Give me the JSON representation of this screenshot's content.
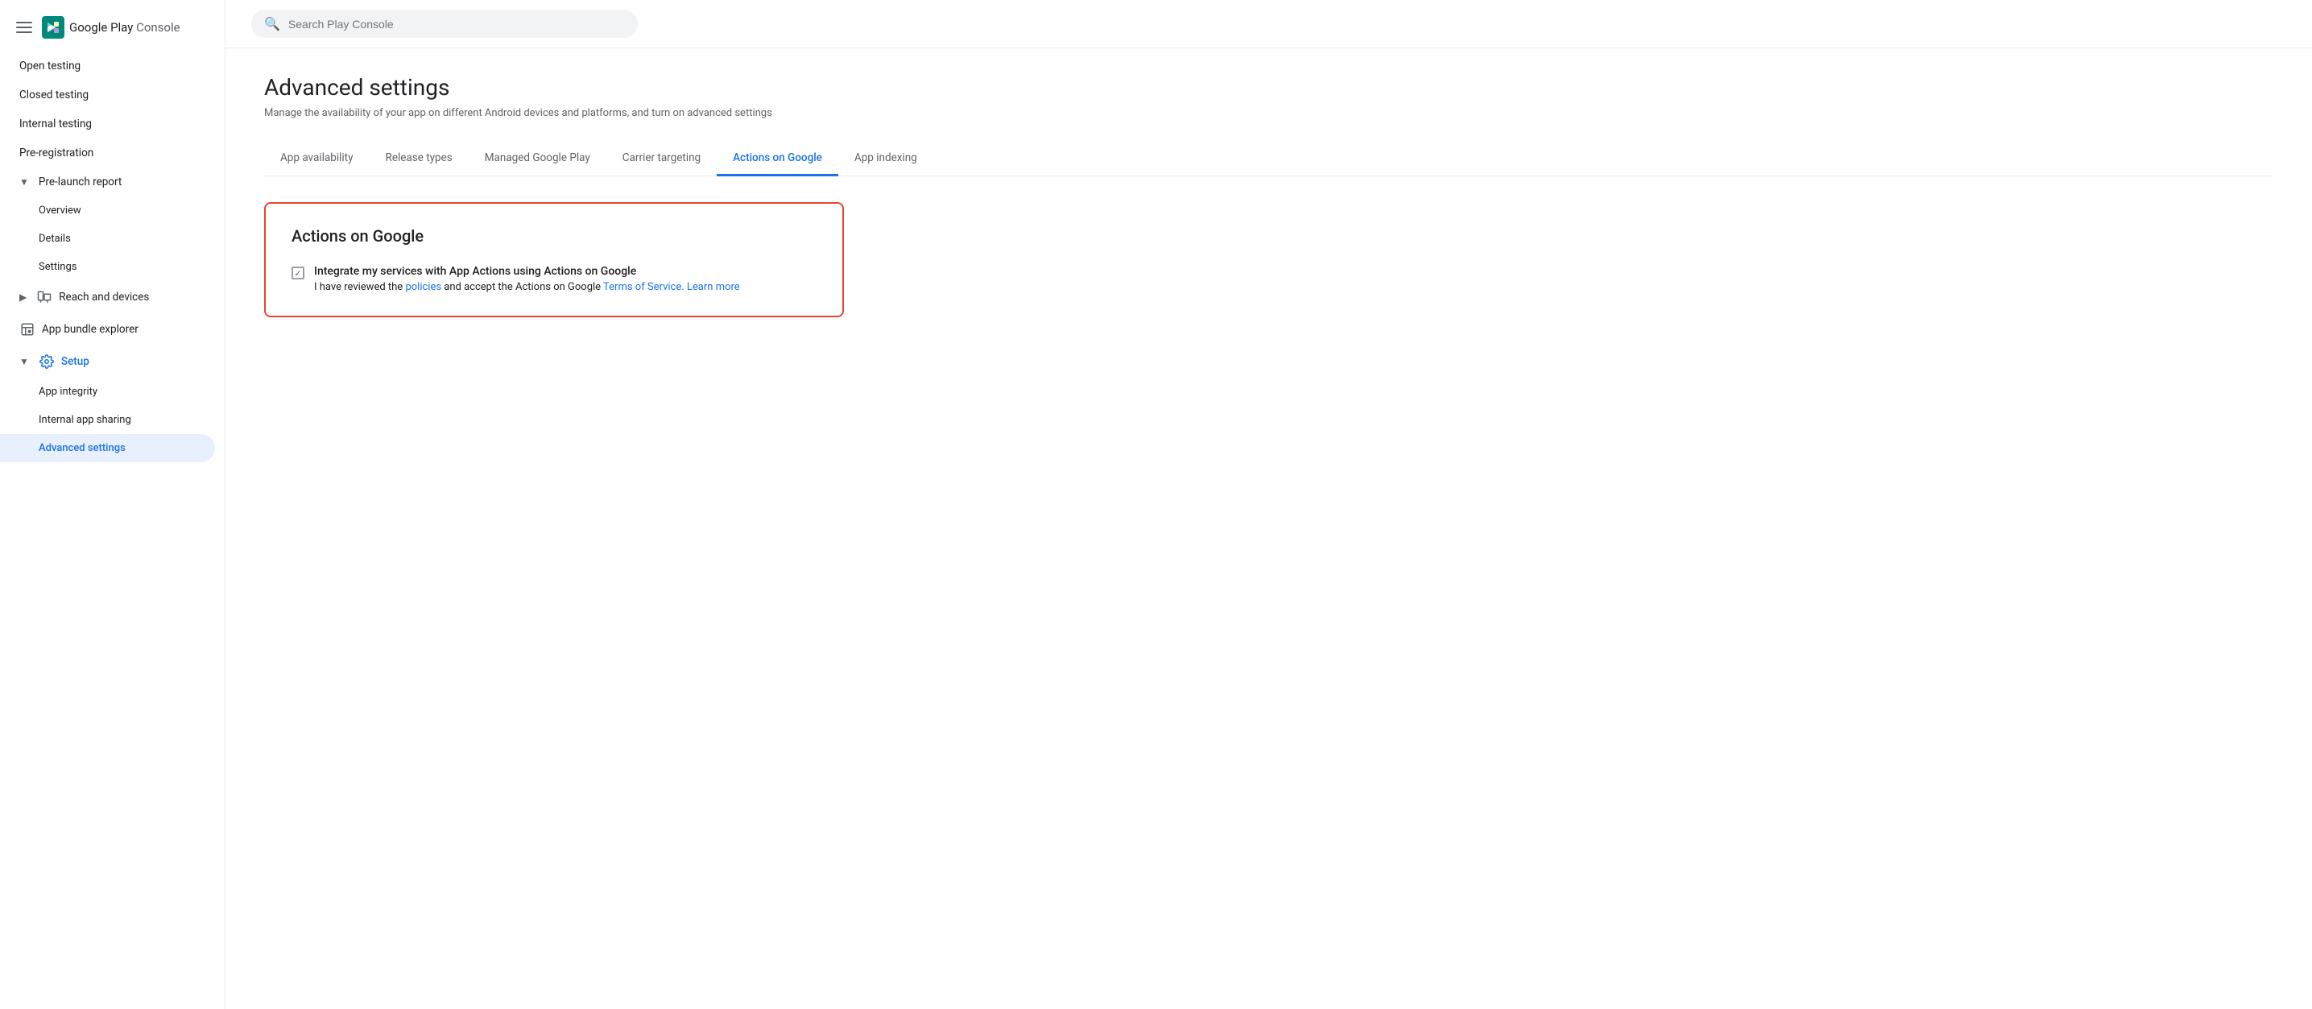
{
  "app": {
    "name": "Google Play Console",
    "name_play": "Google Play",
    "name_console": "Console"
  },
  "search": {
    "placeholder": "Search Play Console"
  },
  "sidebar": {
    "items": [
      {
        "id": "open-testing",
        "label": "Open testing",
        "level": "top"
      },
      {
        "id": "closed-testing",
        "label": "Closed testing",
        "level": "top"
      },
      {
        "id": "internal-testing",
        "label": "Internal testing",
        "level": "top"
      },
      {
        "id": "pre-registration",
        "label": "Pre-registration",
        "level": "top"
      },
      {
        "id": "pre-launch-report",
        "label": "Pre-launch report",
        "level": "section",
        "expanded": true
      },
      {
        "id": "overview",
        "label": "Overview",
        "level": "sub"
      },
      {
        "id": "details",
        "label": "Details",
        "level": "sub"
      },
      {
        "id": "settings",
        "label": "Settings",
        "level": "sub"
      },
      {
        "id": "reach-and-devices",
        "label": "Reach and devices",
        "level": "section-collapsed"
      },
      {
        "id": "app-bundle-explorer",
        "label": "App bundle explorer",
        "level": "top-icon"
      },
      {
        "id": "setup",
        "label": "Setup",
        "level": "section-active",
        "expanded": true
      },
      {
        "id": "app-integrity",
        "label": "App integrity",
        "level": "sub"
      },
      {
        "id": "internal-app-sharing",
        "label": "Internal app sharing",
        "level": "sub"
      },
      {
        "id": "advanced-settings",
        "label": "Advanced settings",
        "level": "sub-active"
      }
    ]
  },
  "page": {
    "title": "Advanced settings",
    "subtitle": "Manage the availability of your app on different Android devices and platforms, and turn on advanced settings"
  },
  "tabs": [
    {
      "id": "app-availability",
      "label": "App availability",
      "active": false
    },
    {
      "id": "release-types",
      "label": "Release types",
      "active": false
    },
    {
      "id": "managed-google-play",
      "label": "Managed Google Play",
      "active": false
    },
    {
      "id": "carrier-targeting",
      "label": "Carrier targeting",
      "active": false
    },
    {
      "id": "actions-on-google",
      "label": "Actions on Google",
      "active": true
    },
    {
      "id": "app-indexing",
      "label": "App indexing",
      "active": false
    }
  ],
  "actions_on_google": {
    "card_title": "Actions on Google",
    "checkbox_label": "Integrate my services with App Actions using Actions on Google",
    "checkbox_desc_prefix": "I have reviewed the ",
    "checkbox_desc_policies": "policies",
    "checkbox_desc_middle": " and accept the Actions on Google ",
    "checkbox_desc_tos": "Terms of Service.",
    "checkbox_desc_learn": " Learn more",
    "checked": true
  }
}
